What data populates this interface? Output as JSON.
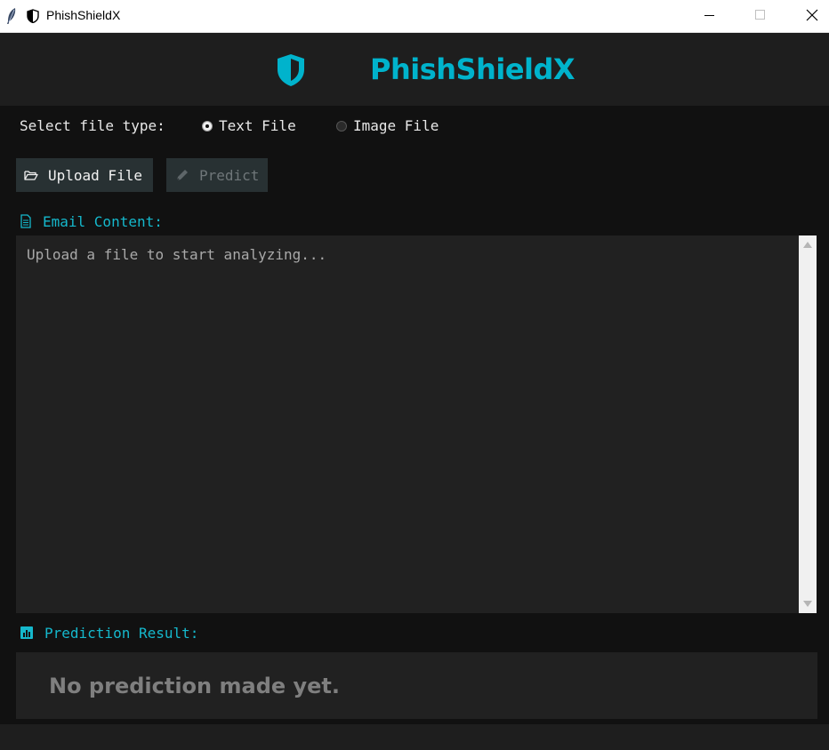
{
  "window": {
    "title": "PhishShieldX",
    "app_icon": "feather-icon",
    "title_icon": "shield-icon"
  },
  "header": {
    "app_name": "PhishShieldX",
    "logo_icon": "shield-icon",
    "accent_color": "#00b3cc"
  },
  "file_type": {
    "label": "Select file type:",
    "options": [
      {
        "label": "Text File",
        "selected": true
      },
      {
        "label": "Image File",
        "selected": false
      }
    ]
  },
  "toolbar": {
    "upload_label": "Upload File",
    "upload_icon": "folder-open-icon",
    "predict_label": "Predict",
    "predict_icon": "pen-icon",
    "predict_enabled": false
  },
  "email": {
    "label": "Email Content:",
    "icon": "document-icon",
    "placeholder": "Upload a file to start analyzing..."
  },
  "prediction": {
    "label": "Prediction Result:",
    "icon": "chart-icon",
    "result": "No prediction made yet."
  }
}
